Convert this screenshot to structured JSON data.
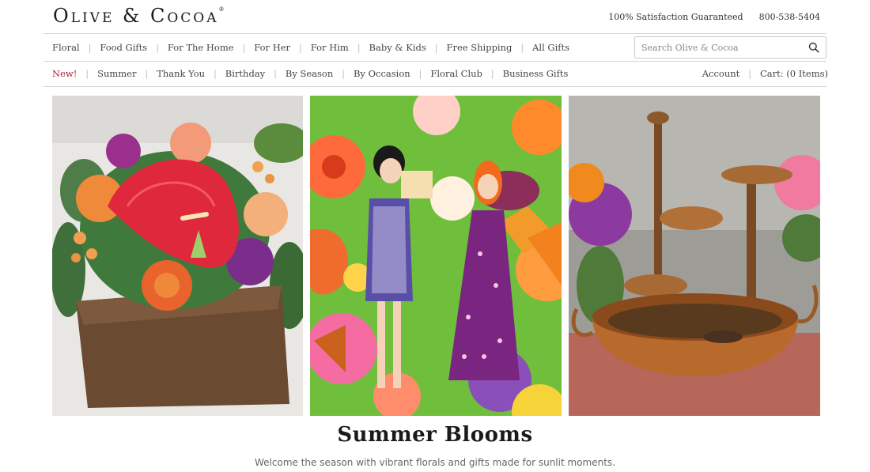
{
  "brand": {
    "logo_text": "Olive & Cocoa",
    "registered": "®"
  },
  "top_bar": {
    "guarantee": "100% Satisfaction Guaranteed",
    "phone": "800-538-5404"
  },
  "primary_nav": [
    "Floral",
    "Food Gifts",
    "For The Home",
    "For Her",
    "For Him",
    "Baby & Kids",
    "Free Shipping",
    "All Gifts"
  ],
  "search": {
    "placeholder": "Search Olive & Cocoa",
    "icon": "search-icon"
  },
  "secondary_nav": [
    "New!",
    "Summer",
    "Thank You",
    "Birthday",
    "By Season",
    "By Occasion",
    "Floral Club",
    "Business Gifts"
  ],
  "account": {
    "account_label": "Account",
    "cart_label": "Cart: (0 Items)"
  },
  "hero": {
    "images": [
      "floral-arrangement-in-wood-box",
      "illustrated-women-in-flowers",
      "copper-bird-fountain"
    ],
    "headline": "Summer Blooms",
    "subtext": "Welcome the season with vibrant florals and gifts made for sunlit moments."
  },
  "colors": {
    "accent_new": "#b01e2f",
    "rule": "#d4d4d4",
    "text": "#333333"
  }
}
